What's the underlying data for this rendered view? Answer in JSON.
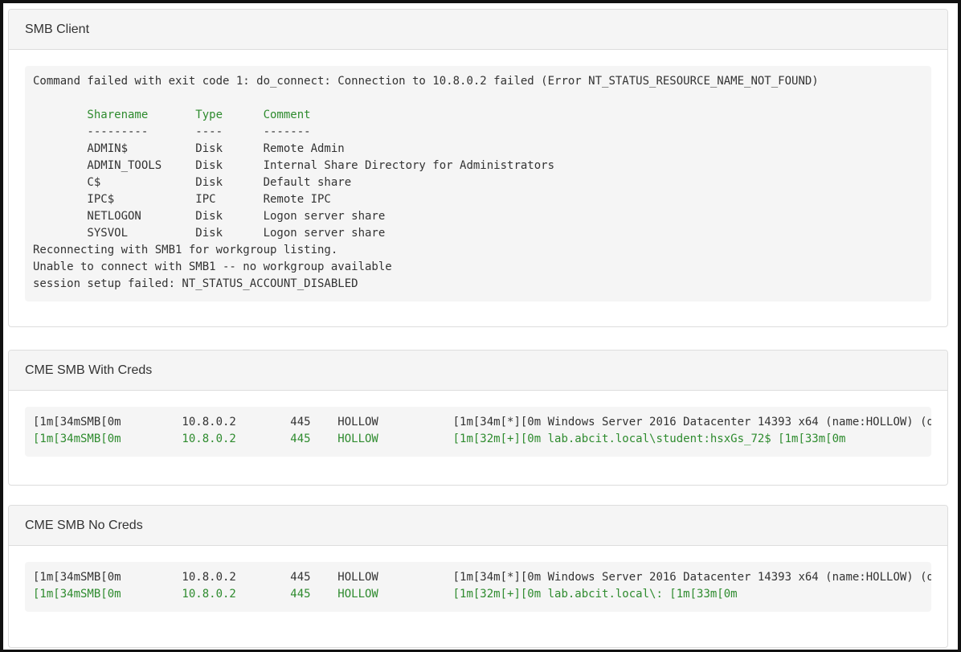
{
  "panels": [
    {
      "title": "SMB Client",
      "lines": [
        {
          "text": "Command failed with exit code 1: do_connect: Connection to 10.8.0.2 failed (Error NT_STATUS_RESOURCE_NAME_NOT_FOUND)",
          "color": "default"
        },
        {
          "text": "",
          "color": "default"
        },
        {
          "text": "        Sharename       Type      Comment",
          "color": "green"
        },
        {
          "text": "        ---------       ----      -------",
          "color": "default"
        },
        {
          "text": "        ADMIN$          Disk      Remote Admin",
          "color": "default"
        },
        {
          "text": "        ADMIN_TOOLS     Disk      Internal Share Directory for Administrators",
          "color": "default"
        },
        {
          "text": "        C$              Disk      Default share",
          "color": "default"
        },
        {
          "text": "        IPC$            IPC       Remote IPC",
          "color": "default"
        },
        {
          "text": "        NETLOGON        Disk      Logon server share",
          "color": "default"
        },
        {
          "text": "        SYSVOL          Disk      Logon server share",
          "color": "default"
        },
        {
          "text": "Reconnecting with SMB1 for workgroup listing.",
          "color": "default"
        },
        {
          "text": "Unable to connect with SMB1 -- no workgroup available",
          "color": "default"
        },
        {
          "text": "session setup failed: NT_STATUS_ACCOUNT_DISABLED",
          "color": "default"
        }
      ]
    },
    {
      "title": "CME SMB With Creds",
      "lines": [
        {
          "text": "[1m[34mSMB[0m         10.8.0.2        445    HOLLOW           [1m[34m[*][0m Windows Server 2016 Datacenter 14393 x64 (name:HOLLOW) (d",
          "color": "default"
        },
        {
          "text": "[1m[34mSMB[0m         10.8.0.2        445    HOLLOW           [1m[32m[+][0m lab.abcit.local\\student:hsxGs_72$ [1m[33m[0m",
          "color": "green"
        }
      ]
    },
    {
      "title": "CME SMB No Creds",
      "lines": [
        {
          "text": "[1m[34mSMB[0m         10.8.0.2        445    HOLLOW           [1m[34m[*][0m Windows Server 2016 Datacenter 14393 x64 (name:HOLLOW) (d",
          "color": "default"
        },
        {
          "text": "[1m[34mSMB[0m         10.8.0.2        445    HOLLOW           [1m[32m[+][0m lab.abcit.local\\: [1m[33m[0m",
          "color": "green"
        }
      ]
    }
  ],
  "colors": {
    "green": "#2e8b2e",
    "default": "#333333",
    "panel_heading_bg": "#f5f5f5",
    "pre_bg": "#f5f5f5",
    "border": "#dddddd"
  }
}
